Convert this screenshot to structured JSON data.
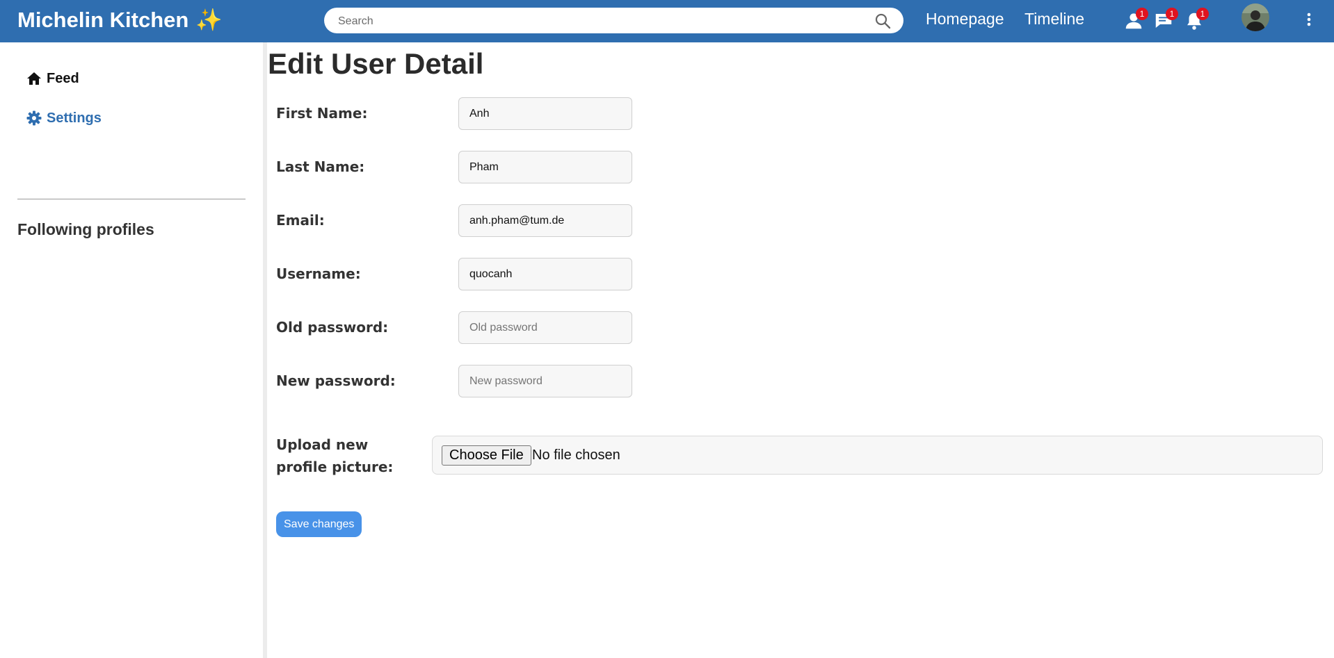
{
  "header": {
    "brand": "Michelin Kitchen",
    "brand_emoji": "✨",
    "search_placeholder": "Search",
    "nav": [
      {
        "label": "Homepage"
      },
      {
        "label": "Timeline"
      }
    ],
    "notifications": [
      {
        "icon": "user-icon",
        "count": "1"
      },
      {
        "icon": "chat-icon",
        "count": "1"
      },
      {
        "icon": "bell-icon",
        "count": "1"
      }
    ],
    "colors": {
      "bar": "#2f6eb0",
      "badge": "#e0131f"
    }
  },
  "sidebar": {
    "items": [
      {
        "label": "Feed",
        "icon": "home-icon",
        "color": "#111111"
      },
      {
        "label": "Settings",
        "icon": "gear-icon",
        "color": "#2f6eb0"
      }
    ],
    "following_heading": "Following profiles"
  },
  "form": {
    "title": "Edit User Detail",
    "fields": [
      {
        "label": "First Name:",
        "value": "Anh",
        "placeholder": ""
      },
      {
        "label": "Last Name:",
        "value": "Pham",
        "placeholder": ""
      },
      {
        "label": "Email:",
        "value": "anh.pham@tum.de",
        "placeholder": ""
      },
      {
        "label": "Username:",
        "value": "quocanh",
        "placeholder": ""
      },
      {
        "label": "Old password:",
        "value": "",
        "placeholder": "Old password"
      },
      {
        "label": "New password:",
        "value": "",
        "placeholder": "New password"
      }
    ],
    "upload_label": "Upload new profile picture:",
    "choose_file_label": "Choose File",
    "no_file_text": "No file chosen",
    "save_label": "Save changes",
    "save_color": "#4892e8"
  }
}
